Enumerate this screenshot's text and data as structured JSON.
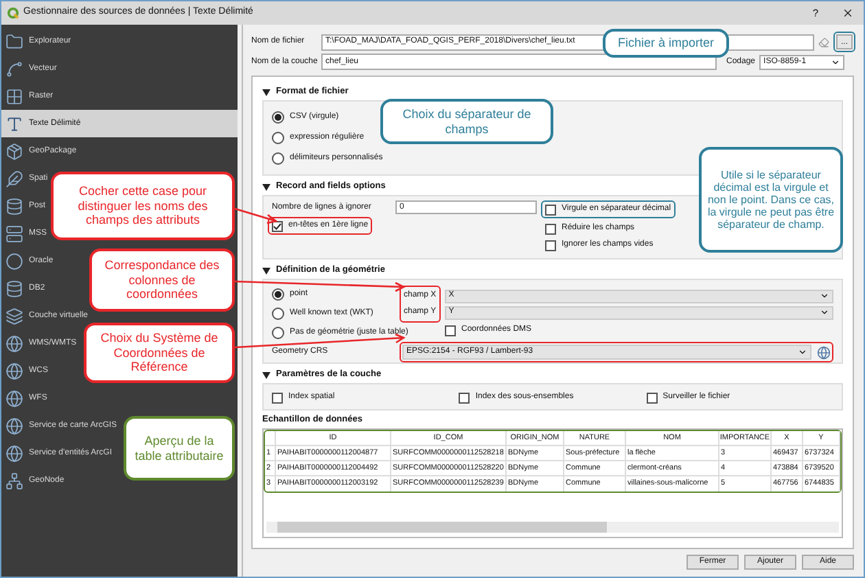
{
  "window": {
    "title": "Gestionnaire des sources de données | Texte Délimité",
    "help": "?"
  },
  "sidebar": {
    "items": [
      {
        "label": "Explorateur",
        "selected": false
      },
      {
        "label": "Vecteur",
        "selected": false
      },
      {
        "label": "Raster",
        "selected": false
      },
      {
        "label": "Texte Délimité",
        "selected": true
      },
      {
        "label": "GeoPackage",
        "selected": false
      },
      {
        "label": "Spati",
        "selected": false
      },
      {
        "label": "Post",
        "selected": false
      },
      {
        "label": "MSS",
        "selected": false
      },
      {
        "label": "Oracle",
        "selected": false
      },
      {
        "label": "DB2",
        "selected": false
      },
      {
        "label": "Couche virtuelle",
        "selected": false
      },
      {
        "label": "WMS/WMTS",
        "selected": false
      },
      {
        "label": "WCS",
        "selected": false
      },
      {
        "label": "WFS",
        "selected": false
      },
      {
        "label": "Service de carte ArcGIS",
        "selected": false
      },
      {
        "label": "Service d'entités ArcGI",
        "selected": false
      },
      {
        "label": "GeoNode",
        "selected": false
      }
    ]
  },
  "file": {
    "label": "Nom de fichier",
    "value": "T:\\FOAD_MAJ\\DATA_FOAD_QGIS_PERF_2018\\Divers\\chef_lieu.txt",
    "browse": "..."
  },
  "layer": {
    "label": "Nom de la couche",
    "value": "chef_lieu"
  },
  "encoding": {
    "label": "Codage",
    "value": "ISO-8859-1"
  },
  "format": {
    "title": "Format de fichier",
    "options": [
      {
        "label": "CSV (virgule)",
        "selected": true
      },
      {
        "label": "expression régulière",
        "selected": false
      },
      {
        "label": "délimiteurs personnalisés",
        "selected": false
      }
    ]
  },
  "records": {
    "title": "Record and fields options",
    "skip_label": "Nombre de lignes à ignorer",
    "skip_value": "0",
    "header": {
      "label": "en-têtes en 1ère ligne",
      "checked": true
    },
    "checks": [
      {
        "label": "Virgule en séparateur décimal",
        "checked": false
      },
      {
        "label": "Réduire les champs",
        "checked": false
      },
      {
        "label": "Ignorer les champs vides",
        "checked": false
      }
    ]
  },
  "geometry": {
    "title": "Définition de la géométrie",
    "options": [
      {
        "label": "point",
        "selected": true
      },
      {
        "label": "Well known text (WKT)",
        "selected": false
      },
      {
        "label": "Pas de géométrie (juste la table)",
        "selected": false
      }
    ],
    "x_label": "champ X",
    "x_value": "X",
    "y_label": "champ Y",
    "y_value": "Y",
    "dms": {
      "label": "Coordonnées DMS",
      "checked": false
    },
    "crs_label": "Geometry CRS",
    "crs_value": "EPSG:2154 - RGF93 / Lambert-93"
  },
  "layer_params": {
    "title": "Paramètres de la couche",
    "checks": [
      {
        "label": "Index spatial",
        "checked": false
      },
      {
        "label": "Index des sous-ensembles",
        "checked": false
      },
      {
        "label": "Surveiller le fichier",
        "checked": false
      }
    ]
  },
  "sample": {
    "title": "Echantillon de données",
    "columns": [
      "",
      "ID",
      "ID_COM",
      "ORIGIN_NOM",
      "NATURE",
      "NOM",
      "IMPORTANCE",
      "X",
      "Y"
    ],
    "rows": [
      [
        "1",
        "PAIHABIT0000000112004877",
        "SURFCOMM0000000112528218",
        "BDNyme",
        "Sous-préfecture",
        "la flèche",
        "3",
        "469437",
        "6737324"
      ],
      [
        "2",
        "PAIHABIT0000000112004492",
        "SURFCOMM0000000112528220",
        "BDNyme",
        "Commune",
        "clermont-créans",
        "4",
        "473884",
        "6739520"
      ],
      [
        "3",
        "PAIHABIT0000000112003192",
        "SURFCOMM0000000112528239",
        "BDNyme",
        "Commune",
        "villaines-sous-malicorne",
        "5",
        "467756",
        "6744835"
      ]
    ]
  },
  "buttons": [
    "Fermer",
    "Ajouter",
    "Aide"
  ],
  "annotations": [
    {
      "text": "Fichier à importer",
      "color": "#2f7f9a"
    },
    {
      "text": "Choix du séparateur de champs",
      "color": "#2f7f9a"
    },
    {
      "text": "Cocher cette case pour distinguer les noms des champs des attributs",
      "color": "#e8262a"
    },
    {
      "text": "Utile si le séparateur décimal est la virgule et non le point. Dans ce cas, la virgule ne peut pas être séparateur de champ.",
      "color": "#2f7f9a"
    },
    {
      "text": "Correspondance des colonnes de coordonnées",
      "color": "#e8262a"
    },
    {
      "text": "Choix du Système de Coordonnées de Référence",
      "color": "#e8262a"
    },
    {
      "text": "Aperçu de la table attributaire",
      "color": "#5f8a2e"
    }
  ]
}
